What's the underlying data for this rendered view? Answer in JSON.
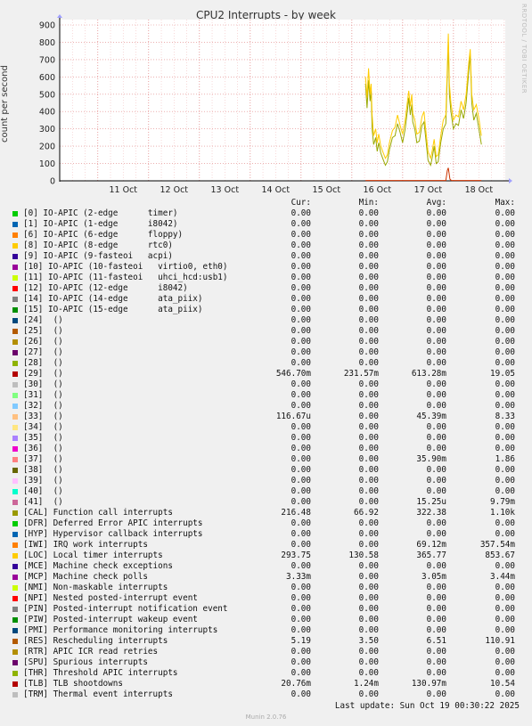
{
  "chart_data": {
    "type": "line",
    "title": "CPU2 Interrupts - by week",
    "ylabel": "count per second",
    "side_label": "RRDTOOL / TOBI OETIKER",
    "ylim": [
      0,
      900
    ],
    "yticks": [
      0,
      100,
      200,
      300,
      400,
      500,
      600,
      700,
      800,
      900
    ],
    "xticks": [
      "11 Oct",
      "12 Oct",
      "13 Oct",
      "14 Oct",
      "15 Oct",
      "16 Oct",
      "17 Oct",
      "18 Oct"
    ],
    "xrange_days": [
      10.25,
      19.02
    ],
    "grid": true,
    "series": [
      {
        "name": "[CAL] Function call interrupts",
        "color": "#99a800",
        "points": [
          [
            16.27,
            560
          ],
          [
            16.3,
            420
          ],
          [
            16.33,
            580
          ],
          [
            16.36,
            460
          ],
          [
            16.38,
            520
          ],
          [
            16.4,
            300
          ],
          [
            16.43,
            210
          ],
          [
            16.47,
            250
          ],
          [
            16.5,
            170
          ],
          [
            16.53,
            220
          ],
          [
            16.57,
            160
          ],
          [
            16.62,
            120
          ],
          [
            16.66,
            90
          ],
          [
            16.7,
            110
          ],
          [
            16.74,
            180
          ],
          [
            16.8,
            250
          ],
          [
            16.85,
            260
          ],
          [
            16.9,
            330
          ],
          [
            16.95,
            280
          ],
          [
            17.0,
            220
          ],
          [
            17.05,
            300
          ],
          [
            17.1,
            420
          ],
          [
            17.12,
            480
          ],
          [
            17.15,
            380
          ],
          [
            17.18,
            440
          ],
          [
            17.2,
            340
          ],
          [
            17.24,
            300
          ],
          [
            17.28,
            220
          ],
          [
            17.33,
            230
          ],
          [
            17.38,
            320
          ],
          [
            17.42,
            340
          ],
          [
            17.45,
            260
          ],
          [
            17.5,
            120
          ],
          [
            17.55,
            90
          ],
          [
            17.58,
            130
          ],
          [
            17.62,
            200
          ],
          [
            17.66,
            100
          ],
          [
            17.7,
            110
          ],
          [
            17.75,
            220
          ],
          [
            17.8,
            300
          ],
          [
            17.85,
            330
          ],
          [
            17.9,
            800
          ],
          [
            17.92,
            500
          ],
          [
            17.95,
            400
          ],
          [
            18.0,
            300
          ],
          [
            18.05,
            330
          ],
          [
            18.1,
            320
          ],
          [
            18.15,
            410
          ],
          [
            18.2,
            360
          ],
          [
            18.25,
            450
          ],
          [
            18.3,
            630
          ],
          [
            18.33,
            730
          ],
          [
            18.36,
            450
          ],
          [
            18.4,
            350
          ],
          [
            18.45,
            390
          ],
          [
            18.5,
            300
          ],
          [
            18.55,
            210
          ]
        ]
      },
      {
        "name": "[LOC] Local timer interrupts",
        "color": "#ffcc00",
        "points": [
          [
            16.27,
            600
          ],
          [
            16.3,
            480
          ],
          [
            16.33,
            650
          ],
          [
            16.36,
            500
          ],
          [
            16.38,
            560
          ],
          [
            16.4,
            380
          ],
          [
            16.43,
            260
          ],
          [
            16.47,
            300
          ],
          [
            16.5,
            220
          ],
          [
            16.53,
            270
          ],
          [
            16.57,
            200
          ],
          [
            16.62,
            160
          ],
          [
            16.66,
            130
          ],
          [
            16.7,
            150
          ],
          [
            16.74,
            220
          ],
          [
            16.8,
            290
          ],
          [
            16.85,
            310
          ],
          [
            16.9,
            380
          ],
          [
            16.95,
            320
          ],
          [
            17.0,
            270
          ],
          [
            17.05,
            350
          ],
          [
            17.1,
            470
          ],
          [
            17.12,
            520
          ],
          [
            17.15,
            430
          ],
          [
            17.18,
            500
          ],
          [
            17.2,
            390
          ],
          [
            17.24,
            350
          ],
          [
            17.28,
            270
          ],
          [
            17.33,
            280
          ],
          [
            17.38,
            370
          ],
          [
            17.42,
            400
          ],
          [
            17.45,
            310
          ],
          [
            17.5,
            170
          ],
          [
            17.55,
            130
          ],
          [
            17.58,
            170
          ],
          [
            17.62,
            240
          ],
          [
            17.66,
            140
          ],
          [
            17.7,
            150
          ],
          [
            17.75,
            260
          ],
          [
            17.8,
            350
          ],
          [
            17.85,
            380
          ],
          [
            17.9,
            850
          ],
          [
            17.92,
            560
          ],
          [
            17.95,
            450
          ],
          [
            18.0,
            350
          ],
          [
            18.05,
            380
          ],
          [
            18.1,
            370
          ],
          [
            18.15,
            460
          ],
          [
            18.2,
            410
          ],
          [
            18.25,
            500
          ],
          [
            18.3,
            680
          ],
          [
            18.33,
            760
          ],
          [
            18.36,
            500
          ],
          [
            18.4,
            410
          ],
          [
            18.45,
            440
          ],
          [
            18.5,
            360
          ],
          [
            18.55,
            260
          ]
        ]
      },
      {
        "name": "[29] ()",
        "color": "#cc3300",
        "points": [
          [
            16.27,
            2
          ],
          [
            17.85,
            2
          ],
          [
            17.88,
            60
          ],
          [
            17.9,
            75
          ],
          [
            17.93,
            10
          ],
          [
            17.96,
            2
          ],
          [
            18.55,
            2
          ]
        ]
      }
    ]
  },
  "legend": {
    "headers": {
      "cur": "Cur:",
      "min": "Min:",
      "avg": "Avg:",
      "max": "Max:"
    },
    "rows": [
      {
        "label": "[0] IO-APIC (2-edge      timer)",
        "color": "#00cc00",
        "cur": "0.00",
        "min": "0.00",
        "avg": "0.00",
        "max": "0.00"
      },
      {
        "label": "[1] IO-APIC (1-edge      i8042)",
        "color": "#0066b3",
        "cur": "0.00",
        "min": "0.00",
        "avg": "0.00",
        "max": "0.00"
      },
      {
        "label": "[6] IO-APIC (6-edge      floppy)",
        "color": "#ff8000",
        "cur": "0.00",
        "min": "0.00",
        "avg": "0.00",
        "max": "0.00"
      },
      {
        "label": "[8] IO-APIC (8-edge      rtc0)",
        "color": "#ffcc00",
        "cur": "0.00",
        "min": "0.00",
        "avg": "0.00",
        "max": "0.00"
      },
      {
        "label": "[9] IO-APIC (9-fasteoi   acpi)",
        "color": "#330099",
        "cur": "0.00",
        "min": "0.00",
        "avg": "0.00",
        "max": "0.00"
      },
      {
        "label": "[10] IO-APIC (10-fasteoi   virtio0, eth0)",
        "color": "#990099",
        "cur": "0.00",
        "min": "0.00",
        "avg": "0.00",
        "max": "0.00"
      },
      {
        "label": "[11] IO-APIC (11-fasteoi   uhci_hcd:usb1)",
        "color": "#ccff00",
        "cur": "0.00",
        "min": "0.00",
        "avg": "0.00",
        "max": "0.00"
      },
      {
        "label": "[12] IO-APIC (12-edge      i8042)",
        "color": "#ff0000",
        "cur": "0.00",
        "min": "0.00",
        "avg": "0.00",
        "max": "0.00"
      },
      {
        "label": "[14] IO-APIC (14-edge      ata_piix)",
        "color": "#808080",
        "cur": "0.00",
        "min": "0.00",
        "avg": "0.00",
        "max": "0.00"
      },
      {
        "label": "[15] IO-APIC (15-edge      ata_piix)",
        "color": "#008f00",
        "cur": "0.00",
        "min": "0.00",
        "avg": "0.00",
        "max": "0.00"
      },
      {
        "label": "[24]  ()",
        "color": "#00487d",
        "cur": "0.00",
        "min": "0.00",
        "avg": "0.00",
        "max": "0.00"
      },
      {
        "label": "[25]  ()",
        "color": "#b35a00",
        "cur": "0.00",
        "min": "0.00",
        "avg": "0.00",
        "max": "0.00"
      },
      {
        "label": "[26]  ()",
        "color": "#b38f00",
        "cur": "0.00",
        "min": "0.00",
        "avg": "0.00",
        "max": "0.00"
      },
      {
        "label": "[27]  ()",
        "color": "#6b006b",
        "cur": "0.00",
        "min": "0.00",
        "avg": "0.00",
        "max": "0.00"
      },
      {
        "label": "[28]  ()",
        "color": "#8fb300",
        "cur": "0.00",
        "min": "0.00",
        "avg": "0.00",
        "max": "0.00"
      },
      {
        "label": "[29]  ()",
        "color": "#b30000",
        "cur": "546.70m",
        "min": "231.57m",
        "avg": "613.28m",
        "max": "19.05"
      },
      {
        "label": "[30]  ()",
        "color": "#bebebe",
        "cur": "0.00",
        "min": "0.00",
        "avg": "0.00",
        "max": "0.00"
      },
      {
        "label": "[31]  ()",
        "color": "#80ff80",
        "cur": "0.00",
        "min": "0.00",
        "avg": "0.00",
        "max": "0.00"
      },
      {
        "label": "[32]  ()",
        "color": "#80c9ff",
        "cur": "0.00",
        "min": "0.00",
        "avg": "0.00",
        "max": "0.00"
      },
      {
        "label": "[33]  ()",
        "color": "#ffc080",
        "cur": "116.67u",
        "min": "0.00",
        "avg": "45.39m",
        "max": "8.33"
      },
      {
        "label": "[34]  ()",
        "color": "#ffe680",
        "cur": "0.00",
        "min": "0.00",
        "avg": "0.00",
        "max": "0.00"
      },
      {
        "label": "[35]  ()",
        "color": "#aa80ff",
        "cur": "0.00",
        "min": "0.00",
        "avg": "0.00",
        "max": "0.00"
      },
      {
        "label": "[36]  ()",
        "color": "#ee00cc",
        "cur": "0.00",
        "min": "0.00",
        "avg": "0.00",
        "max": "0.00"
      },
      {
        "label": "[37]  ()",
        "color": "#ff8080",
        "cur": "0.00",
        "min": "0.00",
        "avg": "35.90m",
        "max": "1.86"
      },
      {
        "label": "[38]  ()",
        "color": "#666600",
        "cur": "0.00",
        "min": "0.00",
        "avg": "0.00",
        "max": "0.00"
      },
      {
        "label": "[39]  ()",
        "color": "#ffbfff",
        "cur": "0.00",
        "min": "0.00",
        "avg": "0.00",
        "max": "0.00"
      },
      {
        "label": "[40]  ()",
        "color": "#00ffcc",
        "cur": "0.00",
        "min": "0.00",
        "avg": "0.00",
        "max": "0.00"
      },
      {
        "label": "[41]  ()",
        "color": "#cc6699",
        "cur": "0.00",
        "min": "0.00",
        "avg": "15.25u",
        "max": "9.79m"
      },
      {
        "label": "[CAL] Function call interrupts",
        "color": "#999900",
        "cur": "216.48",
        "min": "66.92",
        "avg": "322.38",
        "max": "1.10k"
      },
      {
        "label": "[DFR] Deferred Error APIC interrupts",
        "color": "#00cc00",
        "cur": "0.00",
        "min": "0.00",
        "avg": "0.00",
        "max": "0.00"
      },
      {
        "label": "[HYP] Hypervisor callback interrupts",
        "color": "#0066b3",
        "cur": "0.00",
        "min": "0.00",
        "avg": "0.00",
        "max": "0.00"
      },
      {
        "label": "[IWI] IRQ work interrupts",
        "color": "#ff8000",
        "cur": "0.00",
        "min": "0.00",
        "avg": "69.12m",
        "max": "357.54m"
      },
      {
        "label": "[LOC] Local timer interrupts",
        "color": "#ffcc00",
        "cur": "293.75",
        "min": "130.58",
        "avg": "365.77",
        "max": "853.67"
      },
      {
        "label": "[MCE] Machine check exceptions",
        "color": "#330099",
        "cur": "0.00",
        "min": "0.00",
        "avg": "0.00",
        "max": "0.00"
      },
      {
        "label": "[MCP] Machine check polls",
        "color": "#990099",
        "cur": "3.33m",
        "min": "0.00",
        "avg": "3.05m",
        "max": "3.44m"
      },
      {
        "label": "[NMI] Non-maskable interrupts",
        "color": "#ccff00",
        "cur": "0.00",
        "min": "0.00",
        "avg": "0.00",
        "max": "0.00"
      },
      {
        "label": "[NPI] Nested posted-interrupt event",
        "color": "#ff0000",
        "cur": "0.00",
        "min": "0.00",
        "avg": "0.00",
        "max": "0.00"
      },
      {
        "label": "[PIN] Posted-interrupt notification event",
        "color": "#808080",
        "cur": "0.00",
        "min": "0.00",
        "avg": "0.00",
        "max": "0.00"
      },
      {
        "label": "[PIW] Posted-interrupt wakeup event",
        "color": "#008f00",
        "cur": "0.00",
        "min": "0.00",
        "avg": "0.00",
        "max": "0.00"
      },
      {
        "label": "[PMI] Performance monitoring interrupts",
        "color": "#00487d",
        "cur": "0.00",
        "min": "0.00",
        "avg": "0.00",
        "max": "0.00"
      },
      {
        "label": "[RES] Rescheduling interrupts",
        "color": "#b35a00",
        "cur": "5.19",
        "min": "3.50",
        "avg": "6.51",
        "max": "110.91"
      },
      {
        "label": "[RTR] APIC ICR read retries",
        "color": "#b38f00",
        "cur": "0.00",
        "min": "0.00",
        "avg": "0.00",
        "max": "0.00"
      },
      {
        "label": "[SPU] Spurious interrupts",
        "color": "#6b006b",
        "cur": "0.00",
        "min": "0.00",
        "avg": "0.00",
        "max": "0.00"
      },
      {
        "label": "[THR] Threshold APIC interrupts",
        "color": "#8fb300",
        "cur": "0.00",
        "min": "0.00",
        "avg": "0.00",
        "max": "0.00"
      },
      {
        "label": "[TLB] TLB shootdowns",
        "color": "#b30000",
        "cur": "20.76m",
        "min": "1.24m",
        "avg": "130.97m",
        "max": "10.54"
      },
      {
        "label": "[TRM] Thermal event interrupts",
        "color": "#bebebe",
        "cur": "0.00",
        "min": "0.00",
        "avg": "0.00",
        "max": "0.00"
      }
    ]
  },
  "footer": {
    "last_update": "Last update: Sun Oct 19 00:30:22 2025",
    "version": "Munin 2.0.76"
  }
}
